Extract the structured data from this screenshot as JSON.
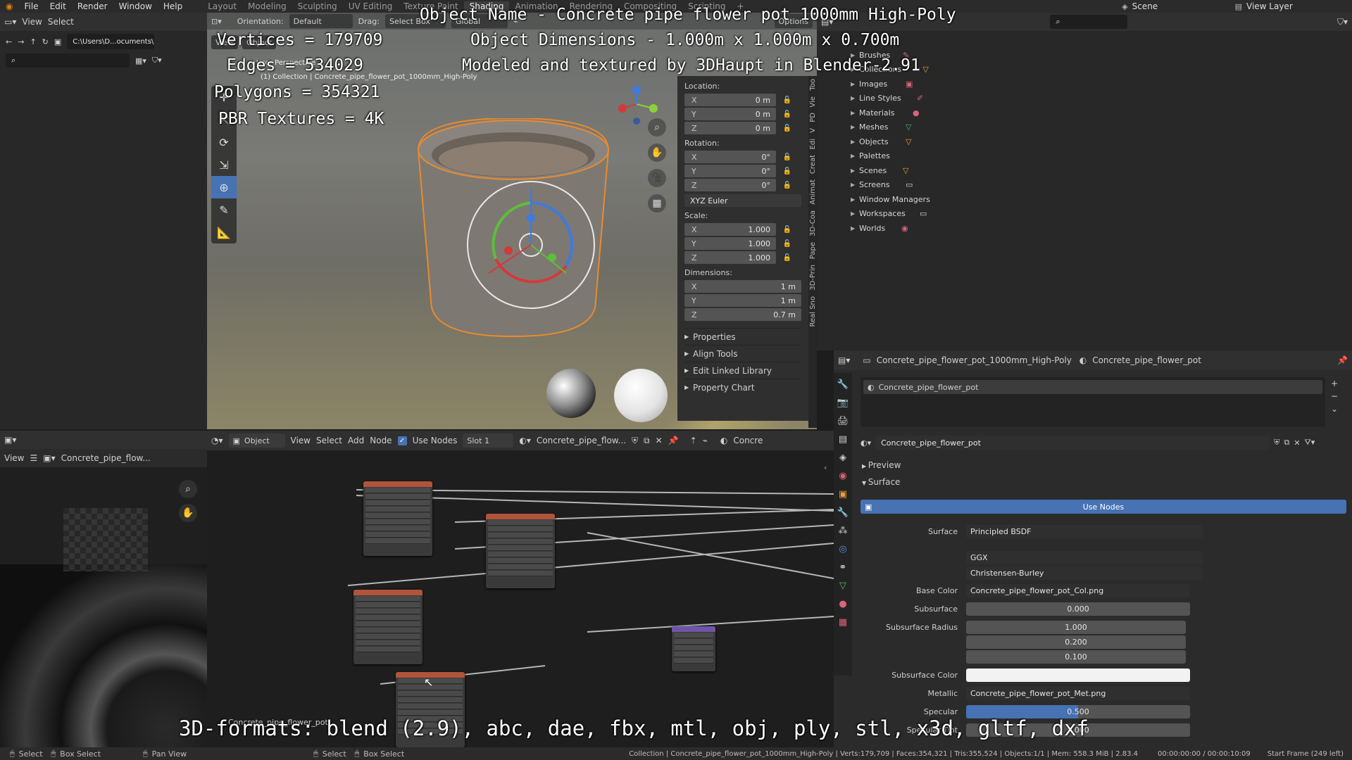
{
  "topbar": {
    "menus": [
      "File",
      "Edit",
      "Render",
      "Window",
      "Help"
    ],
    "workspaces": [
      "Layout",
      "Modeling",
      "Sculpting",
      "UV Editing",
      "Texture Paint",
      "Shading",
      "Animation",
      "Rendering",
      "Compositing",
      "Scripting"
    ],
    "active_workspace": "Shading",
    "add_tab": "+",
    "scene": "Scene",
    "view_layer": "View Layer"
  },
  "overlay": {
    "object_name": "Object Name - Concrete pipe flower pot 1000mm High-Poly",
    "dimensions": "Object Dimensions - 1.000m x 1.000m x 0.700m",
    "credit": "Modeled and textured by 3DHaupt in Blender-2.91",
    "vertices": "Vertices = 179709",
    "edges": "Edges = 534029",
    "polygons": "Polygons = 354321",
    "textures": "PBR Textures = 4K",
    "formats": "3D-formats: blend (2.9), abc, dae, fbx, mtl, obj, ply, stl, x3d, gltf, dxf"
  },
  "file_browser": {
    "header": [
      "View",
      "Select"
    ],
    "path": "C:\\Users\\D...ocuments\\"
  },
  "viewport": {
    "orientation_label": "Orientation:",
    "orientation_value": "Default",
    "drag_label": "Drag:",
    "drag_value": "Select Box",
    "transform_value": "Global",
    "options": "Options",
    "mode": "Object",
    "view": "View",
    "collection_text": "(1) Collection | Concrete_pipe_flower_pot_1000mm_High-Poly",
    "perspective_text": "User Perspective"
  },
  "npanel": {
    "location_label": "Location:",
    "location": [
      {
        "axis": "X",
        "value": "0 m"
      },
      {
        "axis": "Y",
        "value": "0 m"
      },
      {
        "axis": "Z",
        "value": "0 m"
      }
    ],
    "rotation_label": "Rotation:",
    "rotation": [
      {
        "axis": "X",
        "value": "0°"
      },
      {
        "axis": "Y",
        "value": "0°"
      },
      {
        "axis": "Z",
        "value": "0°"
      }
    ],
    "rotation_mode": "XYZ Euler",
    "scale_label": "Scale:",
    "scale": [
      {
        "axis": "X",
        "value": "1.000"
      },
      {
        "axis": "Y",
        "value": "1.000"
      },
      {
        "axis": "Z",
        "value": "1.000"
      }
    ],
    "dimensions_label": "Dimensions:",
    "dimensions": [
      {
        "axis": "X",
        "value": "1 m"
      },
      {
        "axis": "Y",
        "value": "1 m"
      },
      {
        "axis": "Z",
        "value": "0.7 m"
      }
    ],
    "sections": [
      "Properties",
      "Align Tools",
      "Edit Linked Library",
      "Property Chart"
    ],
    "tabs": [
      "Too",
      "Vie",
      "PD",
      "V",
      "Edi",
      "Creat",
      "Animat",
      "3D-Coa",
      "Pape",
      "3D-Prin",
      "Real Sno"
    ]
  },
  "outliner": {
    "items": [
      "Brushes",
      "Collections",
      "Images",
      "Line Styles",
      "Materials",
      "Meshes",
      "Objects",
      "Palettes",
      "Scenes",
      "Screens",
      "Window Managers",
      "Workspaces",
      "Worlds"
    ]
  },
  "properties": {
    "object_name": "Concrete_pipe_flower_pot_1000mm_High-Poly",
    "material_name": "Concrete_pipe_flower_pot",
    "slot_name": "Concrete_pipe_flower_pot",
    "material_field": "Concrete_pipe_flower_pot",
    "preview": "Preview",
    "surface_section": "Surface",
    "use_nodes": "Use Nodes",
    "surface_label": "Surface",
    "surface_value": "Principled BSDF",
    "distribution": "GGX",
    "subsurface_method": "Christensen-Burley",
    "rows": [
      {
        "label": "Base Color",
        "value": "Concrete_pipe_flower_pot_Col.png"
      },
      {
        "label": "Subsurface",
        "value": "0.000"
      },
      {
        "label": "Subsurface Radius",
        "value": "1.000"
      },
      {
        "label": "",
        "value": "0.200"
      },
      {
        "label": "",
        "value": "0.100"
      },
      {
        "label": "Subsurface Color",
        "value": ""
      },
      {
        "label": "Metallic",
        "value": "Concrete_pipe_flower_pot_Met.png"
      },
      {
        "label": "Specular",
        "value": "0.500"
      },
      {
        "label": "Specular Tint",
        "value": "0.000"
      }
    ]
  },
  "node_editor": {
    "mode": "Object",
    "menus": [
      "View",
      "Select",
      "Add",
      "Node"
    ],
    "use_nodes": "Use Nodes",
    "slot": "Slot 1",
    "material": "Concrete_pipe_flow...",
    "material_right": "Concre",
    "frame_label": "Concrete_pipe_flower_pot"
  },
  "image_editor": {
    "view": "View",
    "image": "Concrete_pipe_flow..."
  },
  "statusbar": {
    "left": [
      "Select",
      "Box Select",
      "Pan View",
      "Select",
      "Box Select"
    ],
    "stats": "Collection | Concrete_pipe_flower_pot_1000mm_High-Poly | Verts:179,709 | Faces:354,321 | Tris:355,524 | Objects:1/1 | Mem: 558.3 MiB | 2.83.4",
    "time": "00:00:00:00 / 00:00:10:09",
    "frame": "Start Frame (249 left)"
  }
}
